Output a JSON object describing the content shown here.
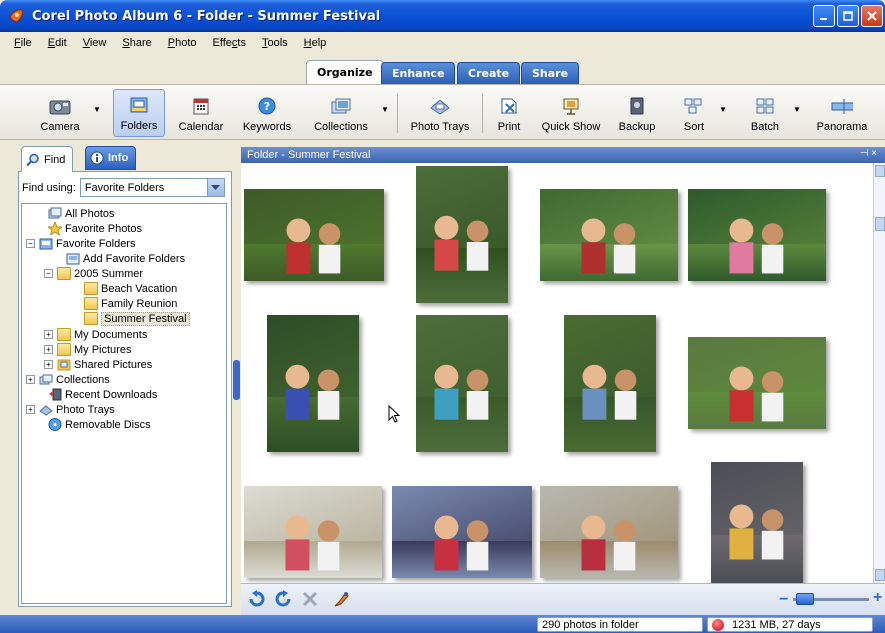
{
  "window": {
    "title": "Corel Photo Album 6 - Folder - Summer Festival",
    "buttons": [
      "minimize",
      "maximize",
      "close"
    ]
  },
  "menu": [
    {
      "label": "File",
      "accel": "F"
    },
    {
      "label": "Edit",
      "accel": "E"
    },
    {
      "label": "View",
      "accel": "V"
    },
    {
      "label": "Share",
      "accel": "S"
    },
    {
      "label": "Photo",
      "accel": "P"
    },
    {
      "label": "Effects",
      "accel": "c"
    },
    {
      "label": "Tools",
      "accel": "T"
    },
    {
      "label": "Help",
      "accel": "H"
    }
  ],
  "tabs": {
    "organize": "Organize",
    "enhance": "Enhance",
    "create": "Create",
    "share": "Share",
    "active": "Organize"
  },
  "toolbar": {
    "camera": "Camera",
    "folders": "Folders",
    "calendar": "Calendar",
    "keywords": "Keywords",
    "collections": "Collections",
    "photo_trays": "Photo Trays",
    "print": "Print",
    "quick_show": "Quick Show",
    "backup": "Backup",
    "sort": "Sort",
    "batch": "Batch",
    "panorama": "Panorama",
    "active": "Folders"
  },
  "left_panel": {
    "find_tab": "Find",
    "info_tab": "Info",
    "find_using_label": "Find using:",
    "find_using_value": "Favorite Folders",
    "tree": {
      "all_photos": "All Photos",
      "favorite_photos": "Favorite Photos",
      "favorite_folders": "Favorite Folders",
      "add_favorite_folders": "Add Favorite Folders",
      "summer_2005": "2005 Summer",
      "beach_vacation": "Beach Vacation",
      "family_reunion": "Family Reunion",
      "summer_festival": "Summer Festival",
      "my_documents": "My Documents",
      "my_pictures": "My Pictures",
      "shared_pictures": "Shared Pictures",
      "collections": "Collections",
      "recent_downloads": "Recent Downloads",
      "photo_trays": "Photo Trays",
      "removable_discs": "Removable Discs",
      "selected": "Summer Festival"
    }
  },
  "folder_view": {
    "header": "Folder - Summer Festival",
    "pin_glyph": "⊣ ×"
  },
  "photos": [
    {
      "name": "kids-picnic-dog",
      "sky": "#3d5a28",
      "ground": "#4f7a2e",
      "accent": "#c03030"
    },
    {
      "name": "girl-watermelon",
      "sky": "#4d6e3a",
      "ground": "#2f4f20",
      "accent": "#d64848"
    },
    {
      "name": "cupcakes-table",
      "sky": "#3e6a32",
      "ground": "#6a9548",
      "accent": "#b03030"
    },
    {
      "name": "kids-running-field",
      "sky": "#2e5a2c",
      "ground": "#5c8a3c",
      "accent": "#e07aa0"
    },
    {
      "name": "mother-daughter",
      "sky": "#2e4d28",
      "ground": "#476b30",
      "accent": "#3a50b0"
    },
    {
      "name": "boy-girl-portrait",
      "sky": "#4d6d3a",
      "ground": "#3a5a2a",
      "accent": "#3ea0c0"
    },
    {
      "name": "two-girls-smiling",
      "sky": "#4a6b32",
      "ground": "#35562a",
      "accent": "#6a90c0"
    },
    {
      "name": "kids-games-field",
      "sky": "#5a7a40",
      "ground": "#5e8c3c",
      "accent": "#c83030"
    },
    {
      "name": "girls-hats",
      "sky": "#dcdcd4",
      "ground": "#b0a890",
      "accent": "#d05060"
    },
    {
      "name": "girl-crafts",
      "sky": "#7a8ab0",
      "ground": "#3a3a5a",
      "accent": "#c83040"
    },
    {
      "name": "girls-bench",
      "sky": "#b8b8b0",
      "ground": "#9c8c6c",
      "accent": "#b83040"
    },
    {
      "name": "boy-guitar",
      "sky": "#4a4f55",
      "ground": "#706a70",
      "accent": "#e0b040"
    }
  ],
  "status": {
    "photo_count": "290 photos in folder",
    "disk_info": "1231 MB, 27 days"
  }
}
